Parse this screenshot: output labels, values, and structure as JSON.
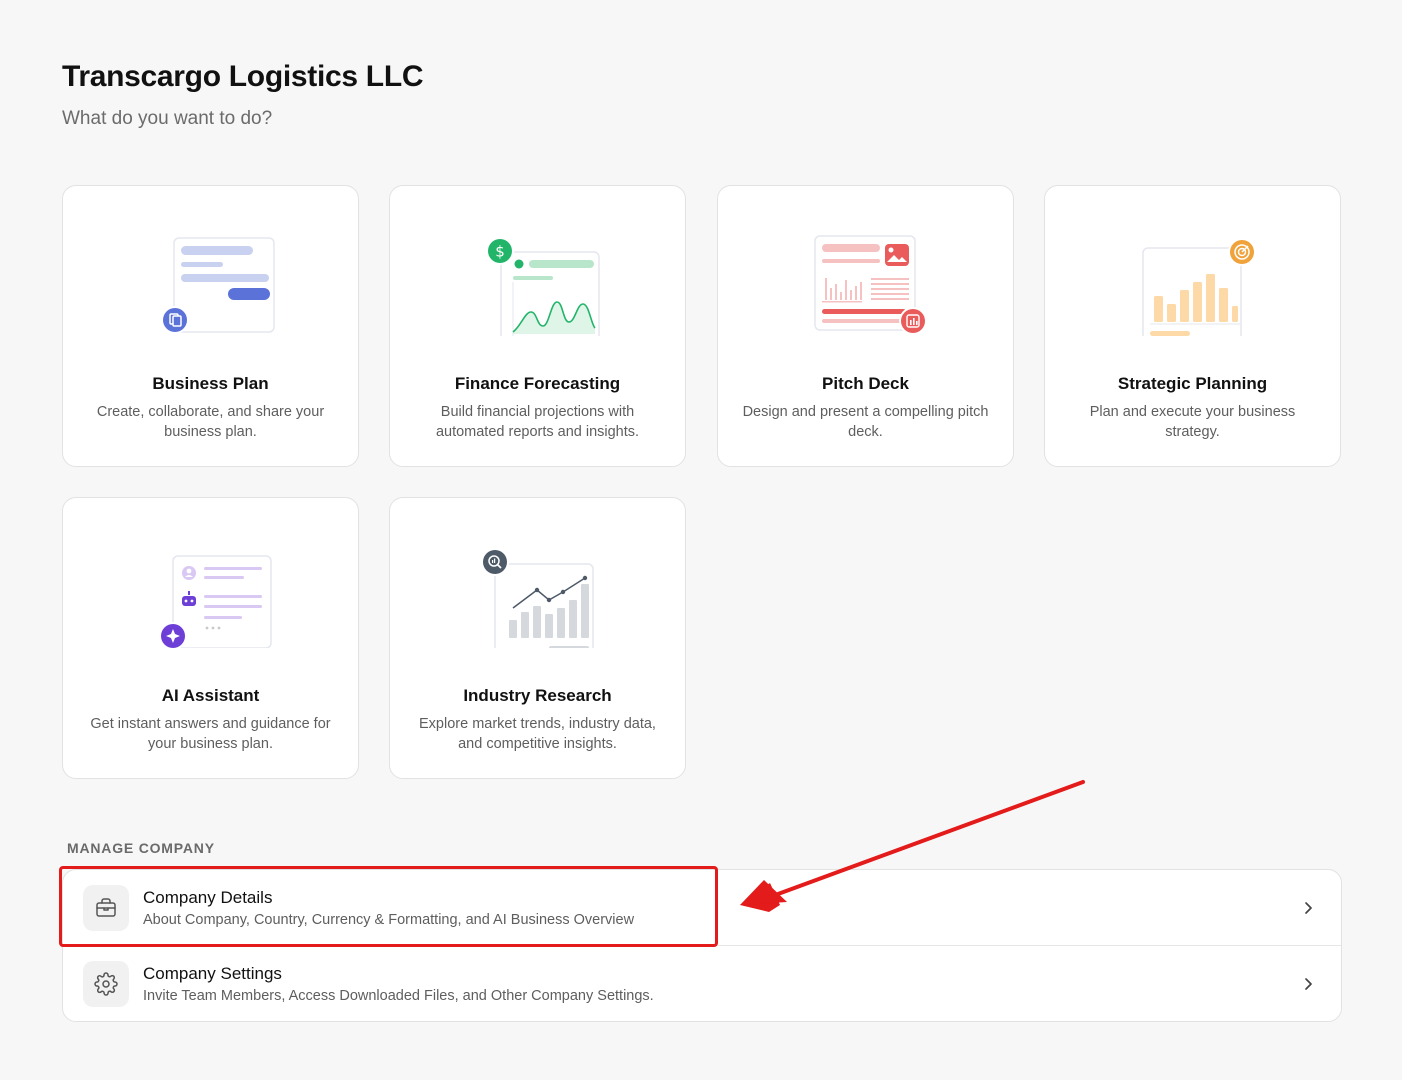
{
  "page": {
    "title": "Transcargo Logistics LLC",
    "subtitle": "What do you want to do?"
  },
  "cards": [
    {
      "title": "Business Plan",
      "description": "Create, collaborate, and share your business plan.",
      "icon": "document-icon",
      "accent": "#5b73d8"
    },
    {
      "title": "Finance Forecasting",
      "description": "Build financial projections with automated reports and insights.",
      "icon": "dollar-icon",
      "accent": "#22b56a"
    },
    {
      "title": "Pitch Deck",
      "description": "Design and present a compelling pitch deck.",
      "icon": "presentation-chart-icon",
      "accent": "#ea5b5b"
    },
    {
      "title": "Strategic Planning",
      "description": "Plan and execute your business strategy.",
      "icon": "target-icon",
      "accent": "#f0a23b"
    },
    {
      "title": "AI Assistant",
      "description": "Get instant answers and guidance for your business plan.",
      "icon": "sparkle-icon",
      "accent": "#6d3fd6"
    },
    {
      "title": "Industry Research",
      "description": "Explore market trends, industry data, and competitive insights.",
      "icon": "magnify-chart-icon",
      "accent": "#4e5a68"
    }
  ],
  "manage": {
    "section_label": "MANAGE COMPANY",
    "items": [
      {
        "title": "Company Details",
        "description": "About Company, Country, Currency & Formatting, and AI Business Overview",
        "icon": "briefcase-icon"
      },
      {
        "title": "Company Settings",
        "description": "Invite Team Members, Access Downloaded Files, and Other Company Settings.",
        "icon": "gear-icon"
      }
    ]
  },
  "annotation": {
    "highlight_color": "#e41b1b",
    "target": "Company Details"
  }
}
